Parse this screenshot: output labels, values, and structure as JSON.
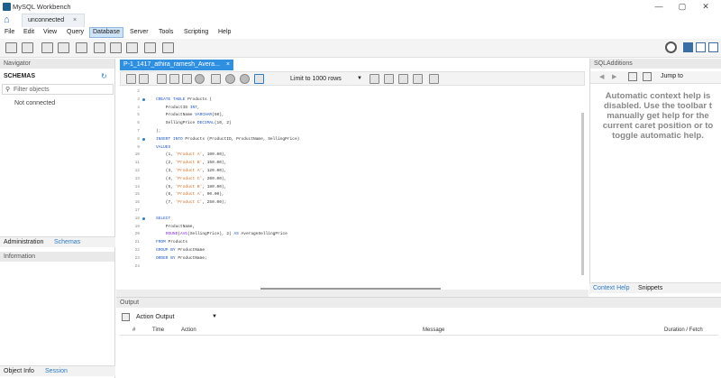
{
  "window": {
    "title": "MySQL Workbench",
    "controls": [
      "—",
      "▢",
      "✕"
    ]
  },
  "connection_tab": {
    "label": "unconnected",
    "close": "×"
  },
  "menu": [
    "File",
    "Edit",
    "View",
    "Query",
    "Database",
    "Server",
    "Tools",
    "Scripting",
    "Help"
  ],
  "active_menu": "Database",
  "navigator": {
    "header": "Navigator",
    "schemas_label": "SCHEMAS",
    "filter_placeholder": "Filter objects",
    "status": "Not connected",
    "tabs1": [
      "Administration",
      "Schemas"
    ],
    "info_header": "Information",
    "tabs2": [
      "Object Info",
      "Session"
    ]
  },
  "query_tab": {
    "label": "P-1_1417_athira_ramesh_Avera...",
    "close": "×"
  },
  "query_toolbar": {
    "limit_label": "Limit to 1000 rows"
  },
  "code_lines": [
    {
      "n": "2",
      "text": ""
    },
    {
      "n": "3",
      "text": "CREATE TABLE Products (",
      "dot": true
    },
    {
      "n": "4",
      "text": "    ProductID INT,"
    },
    {
      "n": "5",
      "text": "    ProductName VARCHAR(50),"
    },
    {
      "n": "6",
      "text": "    SellingPrice DECIMAL(10, 2)"
    },
    {
      "n": "7",
      "text": ");"
    },
    {
      "n": "8",
      "text": "INSERT INTO Products (ProductID, ProductName, SellingPrice)",
      "dot": true
    },
    {
      "n": "9",
      "text": "VALUES"
    },
    {
      "n": "10",
      "text": "    (1, 'Product A', 100.00),"
    },
    {
      "n": "11",
      "text": "    (2, 'Product B', 150.00),"
    },
    {
      "n": "12",
      "text": "    (3, 'Product A', 120.00),"
    },
    {
      "n": "13",
      "text": "    (4, 'Product C', 200.00),"
    },
    {
      "n": "14",
      "text": "    (5, 'Product B', 180.00),"
    },
    {
      "n": "15",
      "text": "    (6, 'Product A', 90.00),"
    },
    {
      "n": "16",
      "text": "    (7, 'Product C', 250.00);"
    },
    {
      "n": "17",
      "text": ""
    },
    {
      "n": "18",
      "text": "SELECT",
      "dot": true
    },
    {
      "n": "19",
      "text": "    ProductName,"
    },
    {
      "n": "20",
      "text": "    ROUND(AVG(SellingPrice), 2) AS AverageSellingPrice"
    },
    {
      "n": "21",
      "text": "FROM Products"
    },
    {
      "n": "22",
      "text": "GROUP BY ProductName"
    },
    {
      "n": "23",
      "text": "ORDER BY ProductName;"
    },
    {
      "n": "24",
      "text": ""
    }
  ],
  "sql_additions": {
    "header": "SQLAdditions",
    "jump_to": "Jump to",
    "help_lines": [
      "Automatic context help is",
      "disabled. Use the toolbar t",
      "manually get help for the",
      "current caret position or to",
      "toggle automatic help."
    ],
    "tabs": [
      "Context Help",
      "Snippets"
    ]
  },
  "output": {
    "header": "Output",
    "selector": "Action Output",
    "columns": [
      "#",
      "Time",
      "Action",
      "Message",
      "Duration / Fetch"
    ]
  },
  "colors": {
    "accent": "#2f8fe0",
    "keyword": "#1a55c7",
    "string": "#d2691e"
  }
}
